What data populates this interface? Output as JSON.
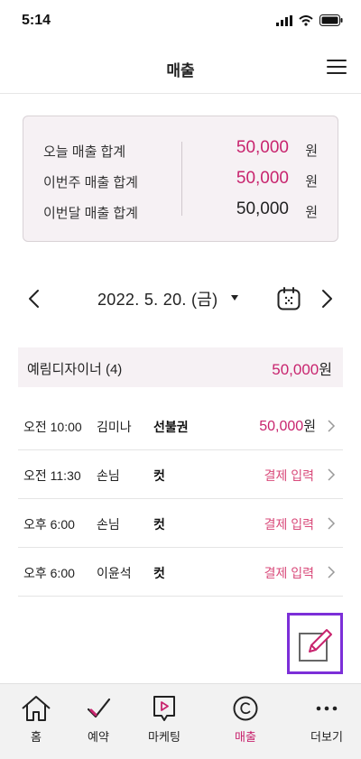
{
  "status_bar": {
    "time": "5:14"
  },
  "nav": {
    "title": "매출"
  },
  "summary": {
    "rows": [
      {
        "label": "오늘 매출 합계",
        "value": "50,000",
        "unit": "원",
        "highlight": true
      },
      {
        "label": "이번주 매출 합계",
        "value": "50,000",
        "unit": "원",
        "highlight": true
      },
      {
        "label": "이번달 매출 합계",
        "value": "50,000",
        "unit": "원",
        "highlight": false
      }
    ]
  },
  "date_nav": {
    "date": "2022. 5. 20. (금)"
  },
  "designer": {
    "name": "예림디자이너 (4)",
    "total": "50,000",
    "unit": "원"
  },
  "appointments": [
    {
      "time": "오전 10:00",
      "customer": "김미나",
      "service": "선불권",
      "amount": "50,000",
      "unit": "원",
      "action": ""
    },
    {
      "time": "오전 11:30",
      "customer": "손님",
      "service": "컷",
      "amount": "",
      "unit": "",
      "action": "결제 입력"
    },
    {
      "time": "오후 6:00",
      "customer": "손님",
      "service": "컷",
      "amount": "",
      "unit": "",
      "action": "결제 입력"
    },
    {
      "time": "오후 6:00",
      "customer": "이윤석",
      "service": "컷",
      "amount": "",
      "unit": "",
      "action": "결제 입력"
    }
  ],
  "tabs": [
    {
      "label": "홈",
      "icon": "home-icon",
      "active": false
    },
    {
      "label": "예약",
      "icon": "check-icon",
      "active": false
    },
    {
      "label": "마케팅",
      "icon": "play-icon",
      "active": false
    },
    {
      "label": "매출",
      "icon": "coin-icon",
      "active": true
    },
    {
      "label": "더보기",
      "icon": "more-icon",
      "active": false
    }
  ],
  "colors": {
    "accent": "#c8246e",
    "highlight_border": "#7c2fd8",
    "card_bg": "#f6f1f4"
  }
}
